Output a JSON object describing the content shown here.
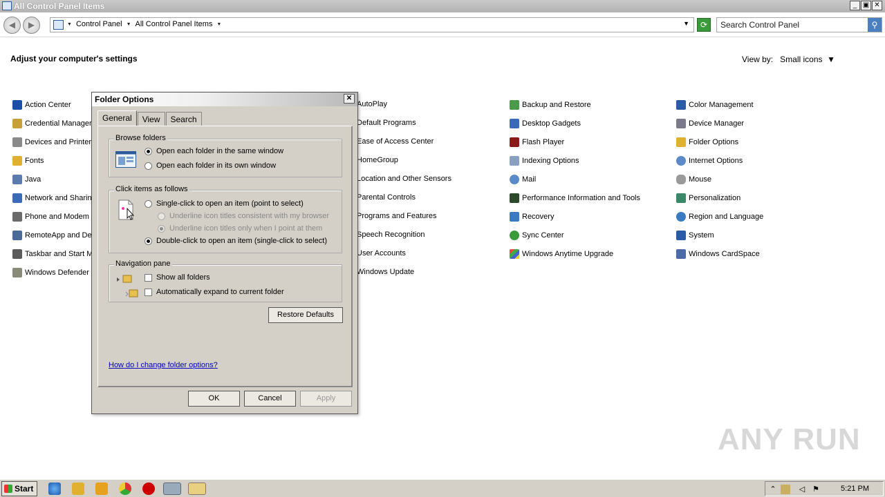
{
  "window": {
    "title": "All Control Panel Items",
    "min": "_",
    "max": "▣",
    "close": "✕"
  },
  "address": {
    "crumbs": [
      "Control Panel",
      "All Control Panel Items"
    ],
    "search_placeholder": "Search Control Panel"
  },
  "heading": "Adjust your computer's settings",
  "viewby": {
    "label": "View by:",
    "value": "Small icons"
  },
  "items": {
    "col1": [
      "Action Center",
      "Credential Manager",
      "Devices and Printers",
      "Fonts",
      "Java",
      "Network and Sharing",
      "Phone and Modem",
      "RemoteApp and Des",
      "Taskbar and Start M",
      "Windows Defender"
    ],
    "col2": [
      "AutoPlay",
      "Default Programs",
      "Ease of Access Center",
      "HomeGroup",
      "Location and Other Sensors",
      "Parental Controls",
      "Programs and Features",
      "Speech Recognition",
      "User Accounts",
      "Windows Update"
    ],
    "col3": [
      "Backup and Restore",
      "Desktop Gadgets",
      "Flash Player",
      "Indexing Options",
      "Mail",
      "Performance Information and Tools",
      "Recovery",
      "Sync Center",
      "Windows Anytime Upgrade"
    ],
    "col4": [
      "Color Management",
      "Device Manager",
      "Folder Options",
      "Internet Options",
      "Mouse",
      "Personalization",
      "Region and Language",
      "System",
      "Windows CardSpace"
    ]
  },
  "dialog": {
    "title": "Folder Options",
    "tabs": [
      "General",
      "View",
      "Search"
    ],
    "browse": {
      "title": "Browse folders",
      "opt1": "Open each folder in the same window",
      "opt2": "Open each folder in its own window"
    },
    "click": {
      "title": "Click items as follows",
      "single": "Single-click to open an item (point to select)",
      "u1": "Underline icon titles consistent with my browser",
      "u2": "Underline icon titles only when I point at them",
      "double": "Double-click to open an item (single-click to select)"
    },
    "nav": {
      "title": "Navigation pane",
      "show": "Show all folders",
      "expand": "Automatically expand to current folder"
    },
    "restore": "Restore Defaults",
    "help": "How do I change folder options?",
    "ok": "OK",
    "cancel": "Cancel",
    "apply": "Apply"
  },
  "watermark": "ANY RUN",
  "taskbar": {
    "start": "Start",
    "time": "5:21 PM"
  }
}
